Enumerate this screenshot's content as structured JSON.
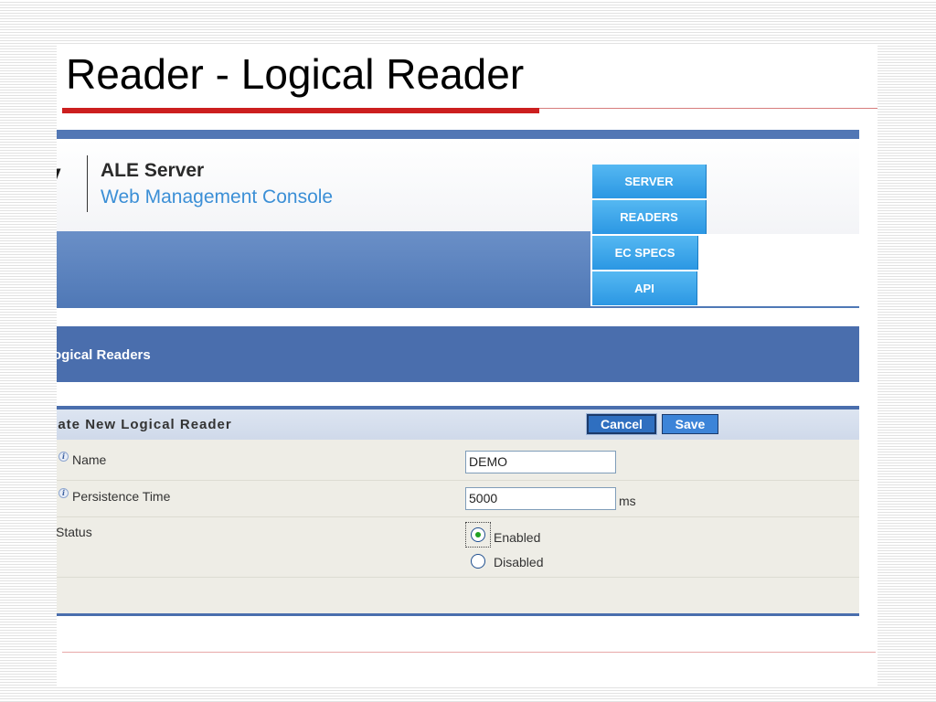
{
  "slide": {
    "title": "Reader - Logical Reader"
  },
  "app": {
    "logo_fragment": "y",
    "name": "ALE Server",
    "subtitle": "Web Management Console"
  },
  "nav": {
    "items": [
      {
        "label": "SERVER"
      },
      {
        "label": "READERS"
      },
      {
        "label": "EC SPECS"
      },
      {
        "label": "API"
      }
    ]
  },
  "section": {
    "title": "ogical Readers"
  },
  "form": {
    "title": "eate New Logical Reader",
    "cancel_label": "Cancel",
    "save_label": "Save",
    "fields": {
      "name": {
        "label": "Name",
        "value": "DEMO"
      },
      "persistence": {
        "label": "Persistence Time",
        "value": "5000",
        "unit": "ms"
      },
      "status": {
        "label": "Status",
        "options": [
          {
            "label": "Enabled",
            "selected": true
          },
          {
            "label": "Disabled",
            "selected": false
          }
        ]
      }
    }
  },
  "colors": {
    "title_rule": "#cc1f1f",
    "banner": "#4f78b6",
    "nav_button": "#2b97e3",
    "section_bar": "#4a6ead"
  }
}
